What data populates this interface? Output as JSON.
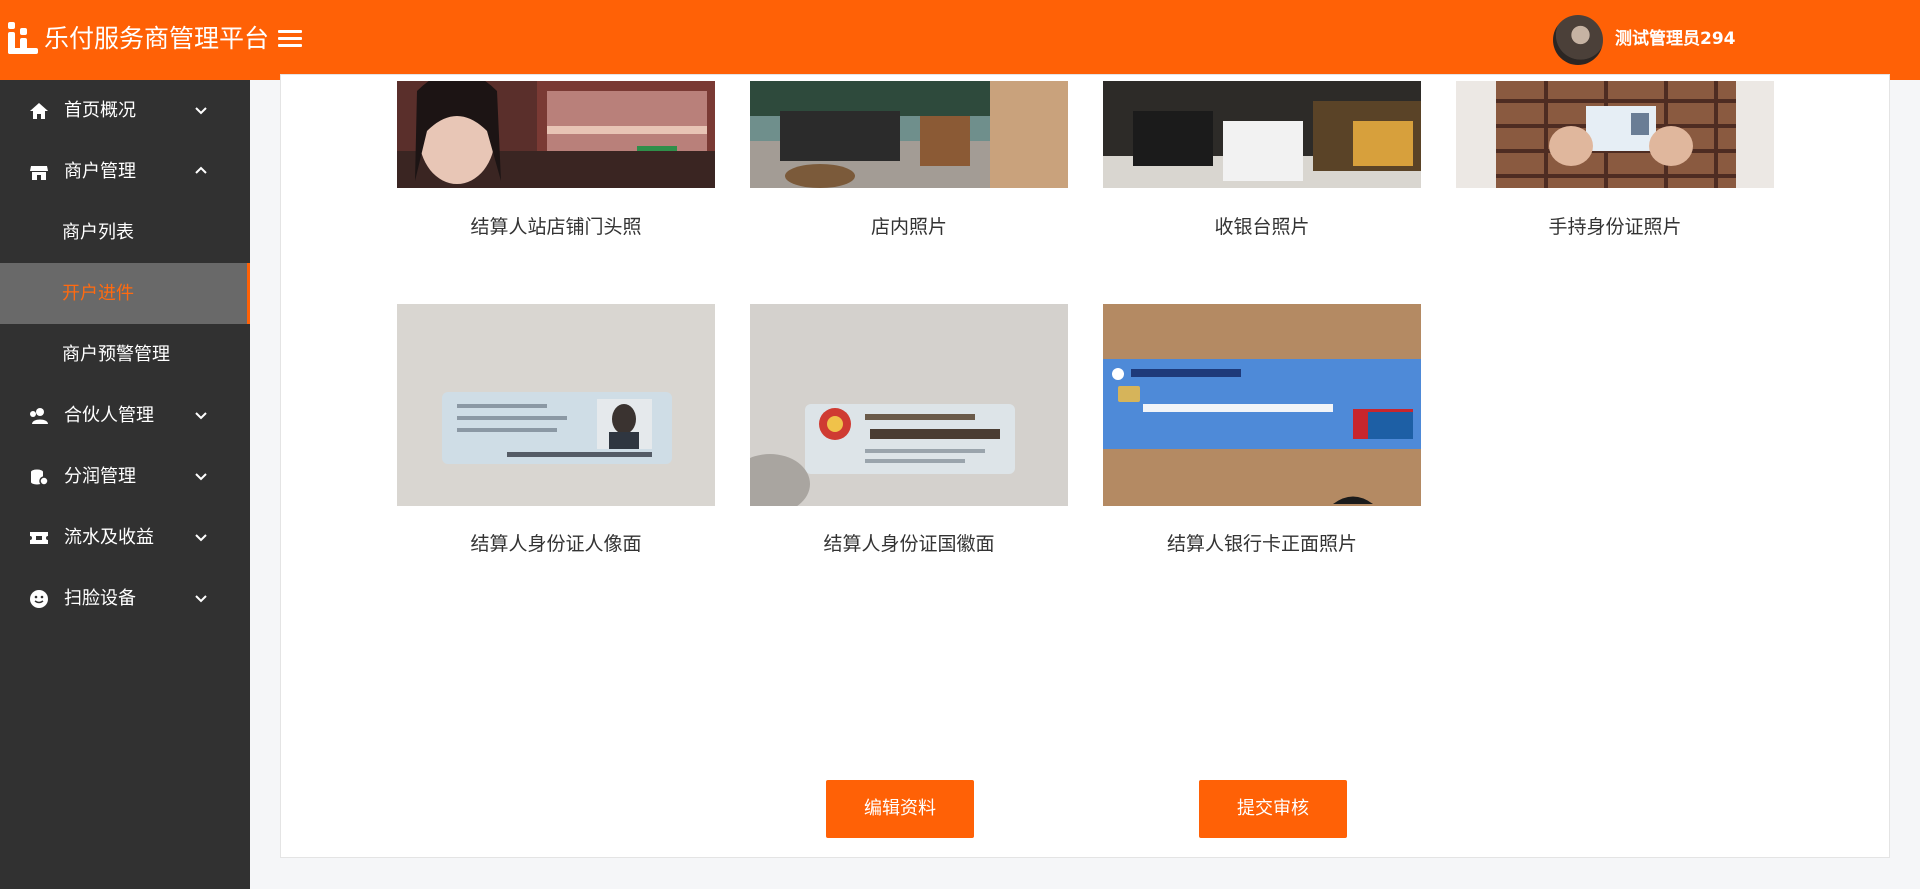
{
  "header": {
    "title": "乐付服务商管理平台",
    "user_name": "测试管理员294"
  },
  "sidebar": {
    "items": [
      {
        "label": "首页概况",
        "icon": "home-icon"
      },
      {
        "label": "商户管理",
        "icon": "store-icon"
      },
      {
        "label": "合伙人管理",
        "icon": "partner-icon"
      },
      {
        "label": "分润管理",
        "icon": "coins-icon"
      },
      {
        "label": "流水及收益",
        "icon": "ticket-icon"
      },
      {
        "label": "扫脸设备",
        "icon": "face-scan-icon"
      }
    ],
    "sub_items": [
      {
        "label": "商户列表"
      },
      {
        "label": "开户进件"
      },
      {
        "label": "商户预警管理"
      }
    ]
  },
  "photos": [
    {
      "caption": "结算人站店铺门头照"
    },
    {
      "caption": "店内照片"
    },
    {
      "caption": "收银台照片"
    },
    {
      "caption": "手持身份证照片"
    },
    {
      "caption": "结算人身份证人像面"
    },
    {
      "caption": "结算人身份证国徽面"
    },
    {
      "caption": "结算人银行卡正面照片"
    }
  ],
  "buttons": {
    "edit": "编辑资料",
    "submit": "提交审核"
  },
  "colors": {
    "brand": "#ff6106",
    "sidebar_bg": "#313131",
    "active_bg": "#696969"
  }
}
